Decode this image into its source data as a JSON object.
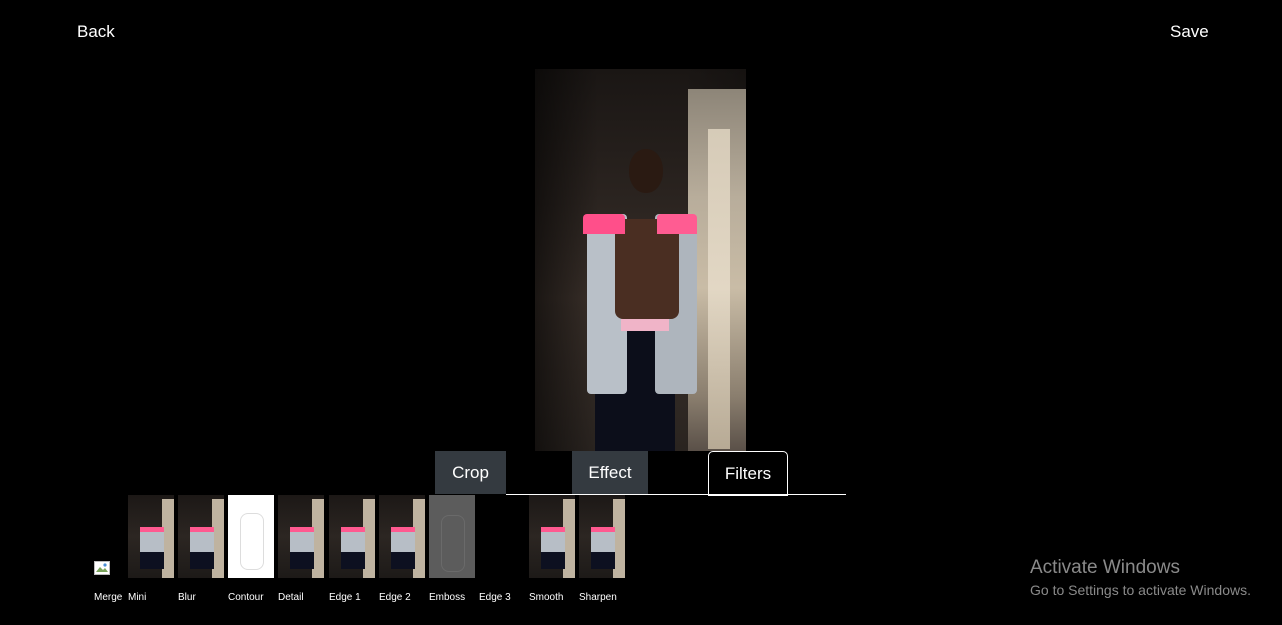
{
  "header": {
    "back_label": "Back",
    "save_label": "Save"
  },
  "tabs": [
    {
      "label": "Crop"
    },
    {
      "label": "Effect"
    },
    {
      "label": "Filters",
      "active": true
    }
  ],
  "filters": [
    {
      "label": "Merge"
    },
    {
      "label": "Mini"
    },
    {
      "label": "Blur"
    },
    {
      "label": "Contour"
    },
    {
      "label": "Detail"
    },
    {
      "label": "Edge 1"
    },
    {
      "label": "Edge 2"
    },
    {
      "label": "Emboss"
    },
    {
      "label": "Edge 3"
    },
    {
      "label": "Smooth"
    },
    {
      "label": "Sharpen"
    }
  ],
  "watermark": {
    "title": "Activate Windows",
    "subtitle": "Go to Settings to activate Windows."
  }
}
